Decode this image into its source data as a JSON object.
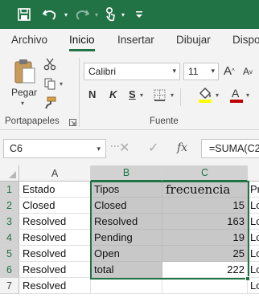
{
  "colors": {
    "accent": "#217346",
    "selection_fill": "#c8c8c8",
    "font_color_bar": "#c00000",
    "highlight_bar": "#ffff00"
  },
  "qat": {
    "icons": [
      "save-icon",
      "undo-icon",
      "redo-icon",
      "touch-mode-icon",
      "customize-qat-icon"
    ]
  },
  "tabs": [
    {
      "label": "Archivo",
      "active": false
    },
    {
      "label": "Inicio",
      "active": true
    },
    {
      "label": "Insertar",
      "active": false
    },
    {
      "label": "Dibujar",
      "active": false
    },
    {
      "label": "Dispo",
      "active": false
    }
  ],
  "ribbon": {
    "clipboard": {
      "paste_label": "Pegar",
      "group_label": "Portapapeles"
    },
    "font": {
      "font_name": "Calibri",
      "font_size": "11",
      "bold": "N",
      "italic": "K",
      "strike": "S",
      "grow": "A",
      "shrink": "A",
      "group_label": "Fuente"
    }
  },
  "formula_bar": {
    "name_box": "C6",
    "fx": "fx",
    "formula": "=SUMA(C2"
  },
  "sheet": {
    "columns": [
      "A",
      "B",
      "C"
    ],
    "rows": [
      "1",
      "2",
      "3",
      "4",
      "5",
      "6",
      "7"
    ],
    "cells": {
      "A": [
        "Estado",
        "Closed",
        "Resolved",
        "Resolved",
        "Resolved",
        "Resolved",
        "Resolved"
      ],
      "B": [
        "Tipos",
        "Closed",
        "Resolved",
        "Pending",
        "Open",
        "total",
        ""
      ],
      "C": [
        "frecuencia",
        "15",
        "163",
        "19",
        "25",
        "222",
        ""
      ],
      "D": [
        "Pr",
        "Lo",
        "Lo",
        "Lo",
        "Lo",
        "Lo",
        "Lo"
      ]
    }
  }
}
